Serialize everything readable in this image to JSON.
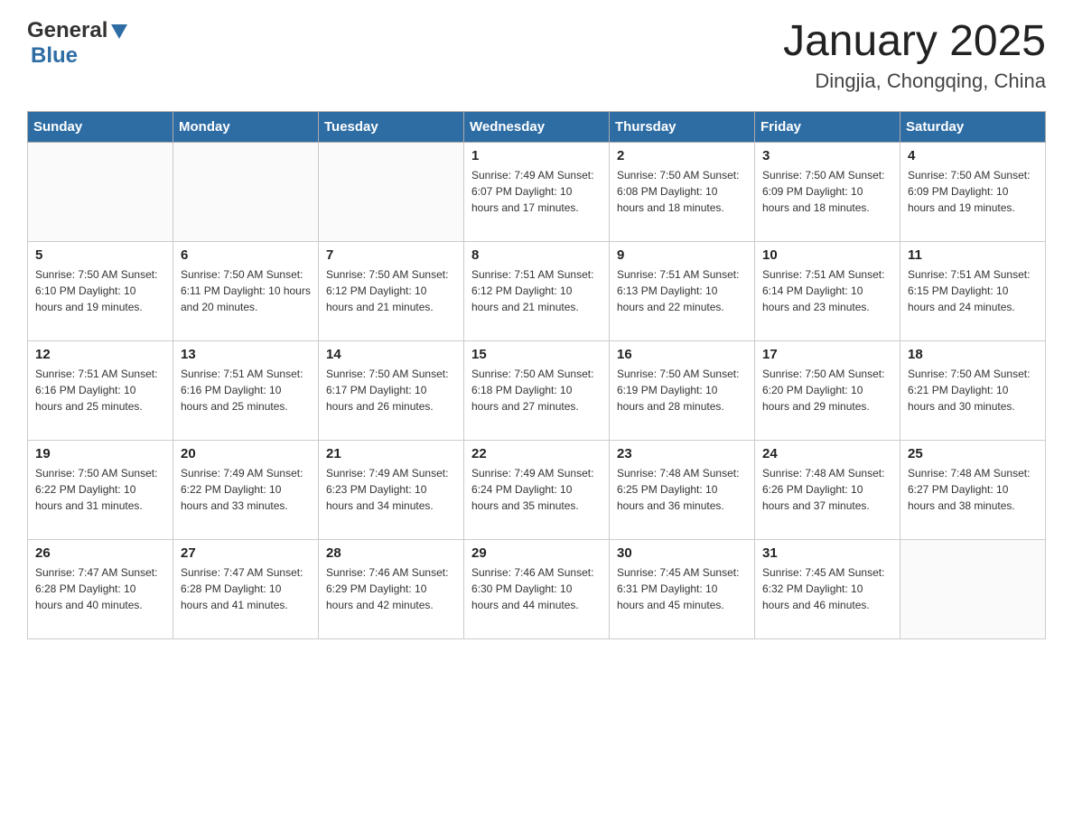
{
  "header": {
    "logo": {
      "general": "General",
      "blue": "Blue"
    },
    "title": "January 2025",
    "location": "Dingjia, Chongqing, China"
  },
  "weekdays": [
    "Sunday",
    "Monday",
    "Tuesday",
    "Wednesday",
    "Thursday",
    "Friday",
    "Saturday"
  ],
  "weeks": [
    [
      {
        "day": "",
        "info": ""
      },
      {
        "day": "",
        "info": ""
      },
      {
        "day": "",
        "info": ""
      },
      {
        "day": "1",
        "info": "Sunrise: 7:49 AM\nSunset: 6:07 PM\nDaylight: 10 hours\nand 17 minutes."
      },
      {
        "day": "2",
        "info": "Sunrise: 7:50 AM\nSunset: 6:08 PM\nDaylight: 10 hours\nand 18 minutes."
      },
      {
        "day": "3",
        "info": "Sunrise: 7:50 AM\nSunset: 6:09 PM\nDaylight: 10 hours\nand 18 minutes."
      },
      {
        "day": "4",
        "info": "Sunrise: 7:50 AM\nSunset: 6:09 PM\nDaylight: 10 hours\nand 19 minutes."
      }
    ],
    [
      {
        "day": "5",
        "info": "Sunrise: 7:50 AM\nSunset: 6:10 PM\nDaylight: 10 hours\nand 19 minutes."
      },
      {
        "day": "6",
        "info": "Sunrise: 7:50 AM\nSunset: 6:11 PM\nDaylight: 10 hours\nand 20 minutes."
      },
      {
        "day": "7",
        "info": "Sunrise: 7:50 AM\nSunset: 6:12 PM\nDaylight: 10 hours\nand 21 minutes."
      },
      {
        "day": "8",
        "info": "Sunrise: 7:51 AM\nSunset: 6:12 PM\nDaylight: 10 hours\nand 21 minutes."
      },
      {
        "day": "9",
        "info": "Sunrise: 7:51 AM\nSunset: 6:13 PM\nDaylight: 10 hours\nand 22 minutes."
      },
      {
        "day": "10",
        "info": "Sunrise: 7:51 AM\nSunset: 6:14 PM\nDaylight: 10 hours\nand 23 minutes."
      },
      {
        "day": "11",
        "info": "Sunrise: 7:51 AM\nSunset: 6:15 PM\nDaylight: 10 hours\nand 24 minutes."
      }
    ],
    [
      {
        "day": "12",
        "info": "Sunrise: 7:51 AM\nSunset: 6:16 PM\nDaylight: 10 hours\nand 25 minutes."
      },
      {
        "day": "13",
        "info": "Sunrise: 7:51 AM\nSunset: 6:16 PM\nDaylight: 10 hours\nand 25 minutes."
      },
      {
        "day": "14",
        "info": "Sunrise: 7:50 AM\nSunset: 6:17 PM\nDaylight: 10 hours\nand 26 minutes."
      },
      {
        "day": "15",
        "info": "Sunrise: 7:50 AM\nSunset: 6:18 PM\nDaylight: 10 hours\nand 27 minutes."
      },
      {
        "day": "16",
        "info": "Sunrise: 7:50 AM\nSunset: 6:19 PM\nDaylight: 10 hours\nand 28 minutes."
      },
      {
        "day": "17",
        "info": "Sunrise: 7:50 AM\nSunset: 6:20 PM\nDaylight: 10 hours\nand 29 minutes."
      },
      {
        "day": "18",
        "info": "Sunrise: 7:50 AM\nSunset: 6:21 PM\nDaylight: 10 hours\nand 30 minutes."
      }
    ],
    [
      {
        "day": "19",
        "info": "Sunrise: 7:50 AM\nSunset: 6:22 PM\nDaylight: 10 hours\nand 31 minutes."
      },
      {
        "day": "20",
        "info": "Sunrise: 7:49 AM\nSunset: 6:22 PM\nDaylight: 10 hours\nand 33 minutes."
      },
      {
        "day": "21",
        "info": "Sunrise: 7:49 AM\nSunset: 6:23 PM\nDaylight: 10 hours\nand 34 minutes."
      },
      {
        "day": "22",
        "info": "Sunrise: 7:49 AM\nSunset: 6:24 PM\nDaylight: 10 hours\nand 35 minutes."
      },
      {
        "day": "23",
        "info": "Sunrise: 7:48 AM\nSunset: 6:25 PM\nDaylight: 10 hours\nand 36 minutes."
      },
      {
        "day": "24",
        "info": "Sunrise: 7:48 AM\nSunset: 6:26 PM\nDaylight: 10 hours\nand 37 minutes."
      },
      {
        "day": "25",
        "info": "Sunrise: 7:48 AM\nSunset: 6:27 PM\nDaylight: 10 hours\nand 38 minutes."
      }
    ],
    [
      {
        "day": "26",
        "info": "Sunrise: 7:47 AM\nSunset: 6:28 PM\nDaylight: 10 hours\nand 40 minutes."
      },
      {
        "day": "27",
        "info": "Sunrise: 7:47 AM\nSunset: 6:28 PM\nDaylight: 10 hours\nand 41 minutes."
      },
      {
        "day": "28",
        "info": "Sunrise: 7:46 AM\nSunset: 6:29 PM\nDaylight: 10 hours\nand 42 minutes."
      },
      {
        "day": "29",
        "info": "Sunrise: 7:46 AM\nSunset: 6:30 PM\nDaylight: 10 hours\nand 44 minutes."
      },
      {
        "day": "30",
        "info": "Sunrise: 7:45 AM\nSunset: 6:31 PM\nDaylight: 10 hours\nand 45 minutes."
      },
      {
        "day": "31",
        "info": "Sunrise: 7:45 AM\nSunset: 6:32 PM\nDaylight: 10 hours\nand 46 minutes."
      },
      {
        "day": "",
        "info": ""
      }
    ]
  ]
}
